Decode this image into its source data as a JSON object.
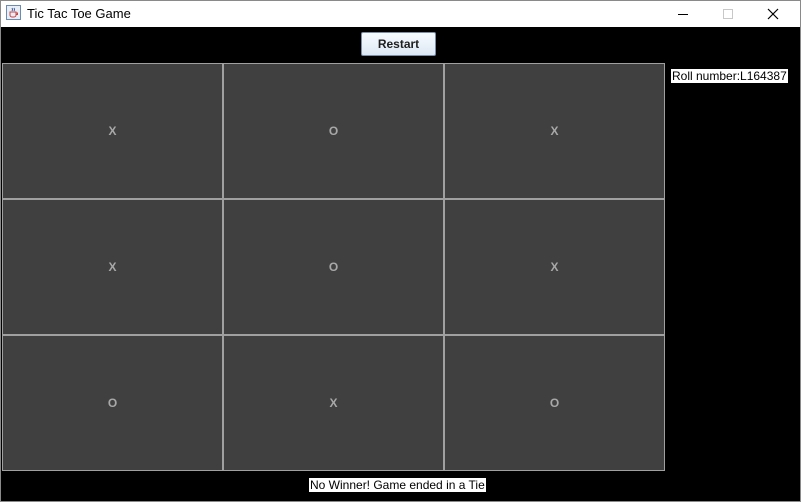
{
  "window": {
    "title": "Tic Tac Toe Game",
    "app_icon": "java-cup-icon",
    "controls": [
      "minimize-icon",
      "maximize-icon",
      "close-icon"
    ]
  },
  "toolbar": {
    "restart_label": "Restart"
  },
  "board": {
    "rows": [
      [
        "X",
        "O",
        "X"
      ],
      [
        "X",
        "O",
        "X"
      ],
      [
        "O",
        "X",
        "O"
      ]
    ]
  },
  "side_panel": {
    "roll_number": "Roll number:L164387"
  },
  "status": {
    "message": "No Winner! Game ended in a Tie"
  },
  "colors": {
    "background": "#000000",
    "cell": "#404040",
    "cell_border": "#a0a0a0",
    "mark": "#a8a8a8"
  }
}
